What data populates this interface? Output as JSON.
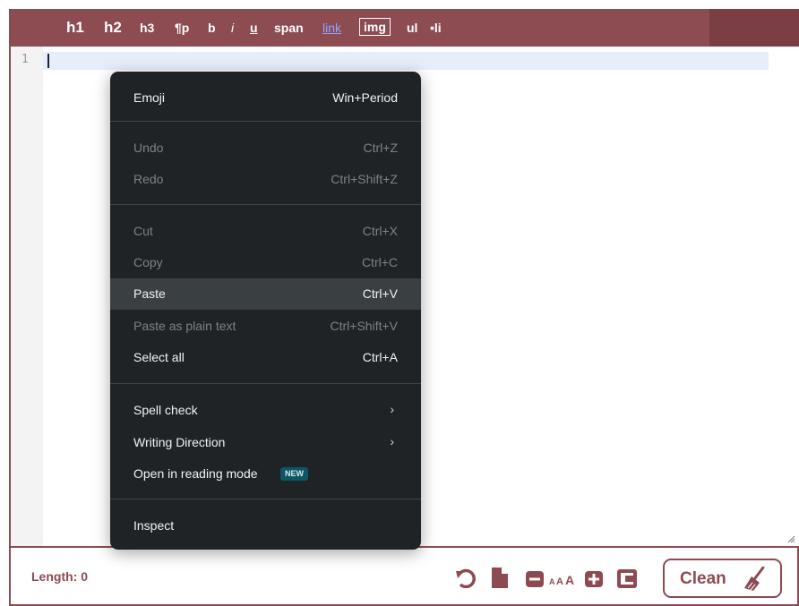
{
  "toolbar": {
    "h1": "h1",
    "h2": "h2",
    "h3": "h3",
    "p": "¶p",
    "b": "b",
    "i": "i",
    "u": "u",
    "span": "span",
    "link": "link",
    "img": "img",
    "ul": "ul",
    "li": "•li"
  },
  "editor": {
    "line_number": "1"
  },
  "context_menu": {
    "emoji": {
      "label": "Emoji",
      "shortcut": "Win+Period"
    },
    "undo": {
      "label": "Undo",
      "shortcut": "Ctrl+Z"
    },
    "redo": {
      "label": "Redo",
      "shortcut": "Ctrl+Shift+Z"
    },
    "cut": {
      "label": "Cut",
      "shortcut": "Ctrl+X"
    },
    "copy": {
      "label": "Copy",
      "shortcut": "Ctrl+C"
    },
    "paste": {
      "label": "Paste",
      "shortcut": "Ctrl+V"
    },
    "paste_plain": {
      "label": "Paste as plain text",
      "shortcut": "Ctrl+Shift+V"
    },
    "select_all": {
      "label": "Select all",
      "shortcut": "Ctrl+A"
    },
    "spell_check": {
      "label": "Spell check"
    },
    "writing_direction": {
      "label": "Writing Direction"
    },
    "reading_mode": {
      "label": "Open in reading mode",
      "badge": "NEW"
    },
    "inspect": {
      "label": "Inspect"
    }
  },
  "statusbar": {
    "length_label": "Length: 0",
    "clean_label": "Clean"
  },
  "colors": {
    "toolbar_bg": "#8c4c52",
    "accent": "#8e4a52",
    "menu_bg": "#1f2326",
    "link": "#8fa8ff"
  }
}
